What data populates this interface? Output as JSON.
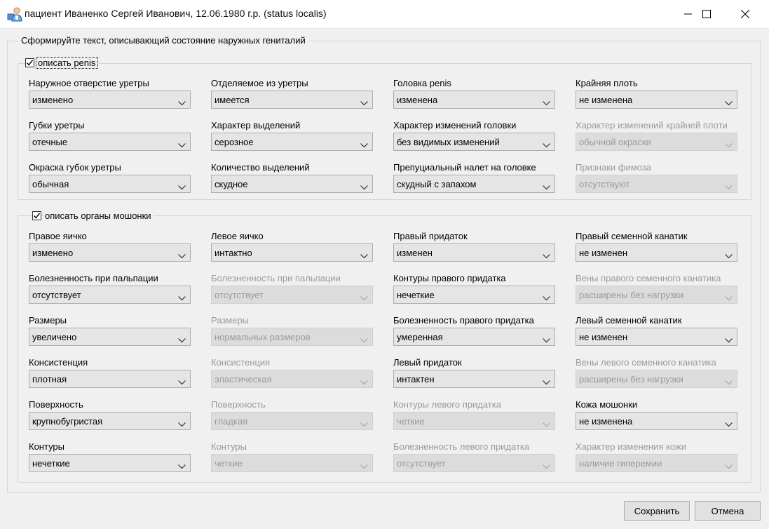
{
  "window": {
    "title": "пациент Иваненко Сергей Иванович, 12.06.1980 г.р. (status localis)",
    "icon": "patient-icon"
  },
  "form": {
    "caption": "Сформируйте текст, описывающий состояние наружных гениталий",
    "penis_group": {
      "checkbox_label": "описать penis",
      "checked": true,
      "fields": [
        {
          "label": "Наружное отверстие уретры",
          "value": "изменено",
          "enabled": true
        },
        {
          "label": "Губки уретры",
          "value": "отечные",
          "enabled": true
        },
        {
          "label": "Окраска губок уретры",
          "value": "обычная",
          "enabled": true
        },
        {
          "label": "Отделяемое из уретры",
          "value": "имеется",
          "enabled": true
        },
        {
          "label": "Характер выделений",
          "value": "серозное",
          "enabled": true
        },
        {
          "label": "Количество выделений",
          "value": "скудное",
          "enabled": true
        },
        {
          "label": "Головка penis",
          "value": "изменена",
          "enabled": true
        },
        {
          "label": "Характер изменений головки",
          "value": "без видимых изменений",
          "enabled": true
        },
        {
          "label": "Препуциальный налет на головке",
          "value": "скудный с запахом",
          "enabled": true
        },
        {
          "label": "Крайняя плоть",
          "value": "не изменена",
          "enabled": true
        },
        {
          "label": "Характер изменений крайней плоти",
          "value": "обычной окраски",
          "enabled": false
        },
        {
          "label": "Признаки фимоза",
          "value": "отсутствуют",
          "enabled": false
        }
      ]
    },
    "scrotum_group": {
      "checkbox_label": "описать органы мошонки",
      "checked": true,
      "fields": [
        {
          "label": "Правое яичко",
          "value": "изменено",
          "enabled": true
        },
        {
          "label": "Болезненность при пальпации",
          "value": "отсутствует",
          "enabled": true
        },
        {
          "label": "Размеры",
          "value": "увеличено",
          "enabled": true
        },
        {
          "label": "Консистенция",
          "value": "плотная",
          "enabled": true
        },
        {
          "label": "Поверхность",
          "value": "крупнобугристая",
          "enabled": true
        },
        {
          "label": "Контуры",
          "value": "нечеткие",
          "enabled": true
        },
        {
          "label": "Левое яичко",
          "value": "интактно",
          "enabled": true
        },
        {
          "label": "Болезненность при пальпации",
          "value": "отсутствует",
          "enabled": false
        },
        {
          "label": "Размеры",
          "value": "нормальных размеров",
          "enabled": false
        },
        {
          "label": "Консистенция",
          "value": "эластическая",
          "enabled": false
        },
        {
          "label": "Поверхность",
          "value": "гладкая",
          "enabled": false
        },
        {
          "label": "Контуры",
          "value": "четкие",
          "enabled": false
        },
        {
          "label": "Правый придаток",
          "value": "изменен",
          "enabled": true
        },
        {
          "label": "Контуры правого придатка",
          "value": "нечеткие",
          "enabled": true
        },
        {
          "label": "Болезненность правого придатка",
          "value": "умеренная",
          "enabled": true
        },
        {
          "label": "Левый придаток",
          "value": "интактен",
          "enabled": true
        },
        {
          "label": "Контуры левого придатка",
          "value": "четкие",
          "enabled": false
        },
        {
          "label": "Болезненность левого придатка",
          "value": "отсутствует",
          "enabled": false
        },
        {
          "label": "Правый семенной канатик",
          "value": "не изменен",
          "enabled": true
        },
        {
          "label": "Вены правого семенного канатика",
          "value": "расширены без нагрузки",
          "enabled": false
        },
        {
          "label": "Левый семенной канатик",
          "value": "не изменен",
          "enabled": true
        },
        {
          "label": "Вены левого семенного канатика",
          "value": "расширены без нагрузки",
          "enabled": false
        },
        {
          "label": "Кожа мошонки",
          "value": "не изменена",
          "enabled": true
        },
        {
          "label": "Характер изменения кожи",
          "value": "наличие гиперемии",
          "enabled": false
        }
      ]
    }
  },
  "buttons": {
    "save": "Сохранить",
    "cancel": "Отмена"
  }
}
